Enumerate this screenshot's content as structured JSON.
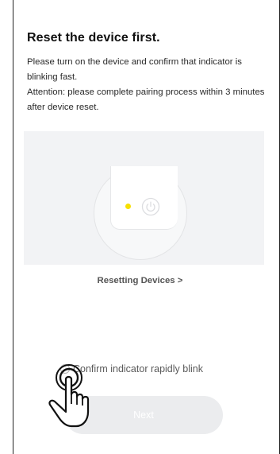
{
  "header": {
    "title": "Reset the device first."
  },
  "instructions": {
    "line1": "Please turn on the device and confirm that indicator is blinking fast.",
    "line2": "Attention: please complete pairing process within 3 minutes after device reset."
  },
  "illustration": {
    "device_icon": "power-icon",
    "indicator_color": "#f7e000"
  },
  "reset_link": {
    "label": "Resetting Devices >"
  },
  "confirm": {
    "label": "Confirm indicator rapidly blink",
    "checked": false
  },
  "footer": {
    "next_label": "Next"
  },
  "overlay": {
    "icon": "tap-hand-icon"
  }
}
